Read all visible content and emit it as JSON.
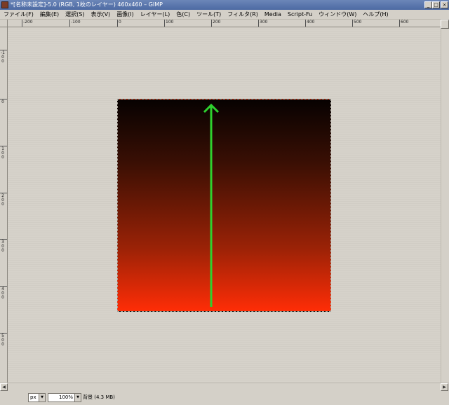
{
  "window": {
    "title": "*[名称未設定]-5.0 (RGB, 1枚のレイヤー) 460x460 – GIMP",
    "buttons": {
      "minimize": "_",
      "maximize": "□",
      "close": "×"
    }
  },
  "menubar": {
    "items": [
      "ファイル(F)",
      "編集(E)",
      "選択(S)",
      "表示(V)",
      "画像(I)",
      "レイヤー(L)",
      "色(C)",
      "ツール(T)",
      "フィルタ(R)",
      "Media",
      "Script-Fu",
      "ウィンドウ(W)",
      "ヘルプ(H)"
    ]
  },
  "rulers": {
    "horizontal_labels": [
      "-200",
      "-100",
      "0",
      "100",
      "200",
      "300",
      "400",
      "500",
      "600"
    ],
    "vertical_labels": [
      "-100",
      "0",
      "100",
      "200",
      "300",
      "400",
      "500"
    ]
  },
  "canvas": {
    "gradient_top_color": "#070201",
    "gradient_bottom_color": "#ff2d06",
    "arrow_color": "#2ed12e"
  },
  "statusbar": {
    "unit": "px",
    "zoom": "100%",
    "layer_info": "背景 (4.3 MB)"
  },
  "icons": [
    "gimp-app-icon",
    "navigate-icon",
    "quick-mask-icon",
    "arrow-left-icon",
    "arrow-right-icon",
    "dropdown-icon"
  ]
}
